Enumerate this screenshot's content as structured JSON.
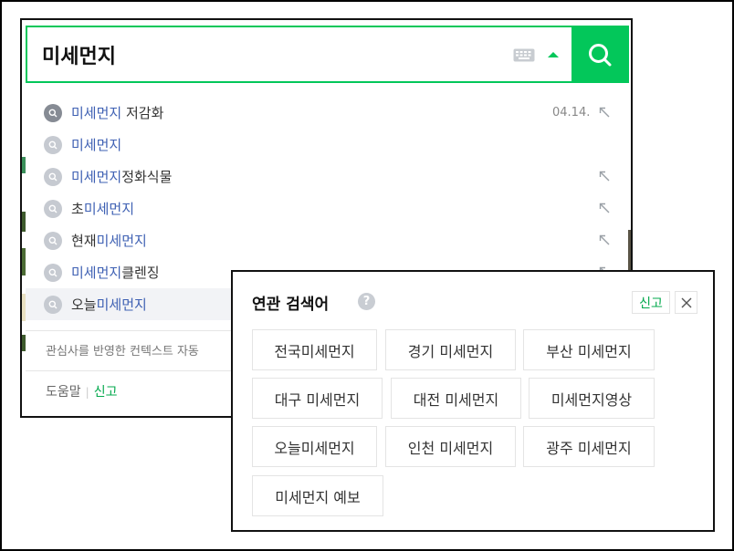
{
  "search": {
    "query": "미세먼지"
  },
  "suggestions": [
    {
      "keyword": "미세먼지",
      "prefix": "",
      "suffix": " 저감화",
      "date": "04.14."
    },
    {
      "keyword": "미세먼지",
      "prefix": "",
      "suffix": "",
      "date": ""
    },
    {
      "keyword": "미세먼지",
      "prefix": "",
      "suffix": "정화식물",
      "date": ""
    },
    {
      "keyword": "미세먼지",
      "prefix": "초",
      "suffix": "",
      "date": ""
    },
    {
      "keyword": "미세먼지",
      "prefix": "현재",
      "suffix": "",
      "date": ""
    },
    {
      "keyword": "미세먼지",
      "prefix": "",
      "suffix": "클렌징",
      "date": ""
    },
    {
      "keyword": "미세먼지",
      "prefix": "오늘",
      "suffix": "",
      "date": ""
    }
  ],
  "context_note": "관심사를 반영한 컨텍스트 자동",
  "footer": {
    "help": "도움말",
    "report": "신고"
  },
  "related": {
    "title": "연관 검색어",
    "help_symbol": "?",
    "report": "신고",
    "keywords": [
      "전국미세먼지",
      "경기 미세먼지",
      "부산 미세먼지",
      "대구 미세먼지",
      "대전 미세먼지",
      "미세먼지영상",
      "오늘미세먼지",
      "인천 미세먼지",
      "광주 미세먼지",
      "미세먼지 예보"
    ]
  },
  "colors": {
    "brand": "#03c75a",
    "keyword": "#3e60b3",
    "report": "#03a94d"
  }
}
